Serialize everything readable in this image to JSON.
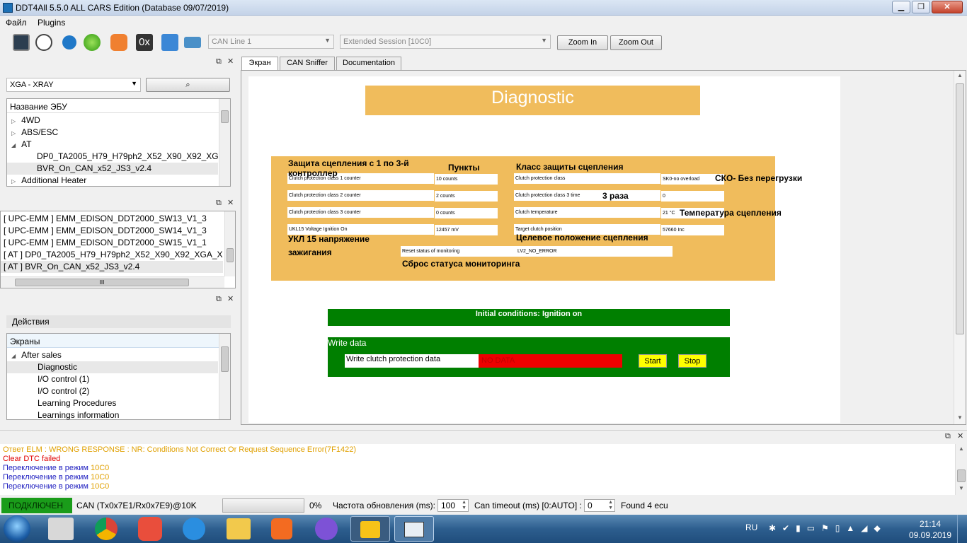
{
  "window": {
    "title": "DDT4All 5.5.0 ALL CARS Edition (Database 09/07/2019)",
    "min": "▁",
    "max": "❐",
    "close": "✕"
  },
  "menu": [
    "Файл",
    "Plugins"
  ],
  "toolbar": {
    "icons": [
      "scan-ecu-icon",
      "bug-icon",
      "refresh-icon",
      "connect-icon",
      "heart-icon",
      "hex-icon",
      "network-icon",
      "settings-icon"
    ],
    "hex_label": "0x",
    "can_line": "CAN Line 1",
    "session": "Extended Session [10C0]",
    "zoom_in": "Zoom In",
    "zoom_out": "Zoom Out"
  },
  "ecu_panel": {
    "selected_vehicle": "XGA - XRAY",
    "header": "Название ЭБУ",
    "items": [
      {
        "label": "4WD",
        "level": 0,
        "expander": "▷"
      },
      {
        "label": "ABS/ESC",
        "level": 0,
        "expander": "▷"
      },
      {
        "label": "AT",
        "level": 0,
        "expander": "◢"
      },
      {
        "label": "DP0_TA2005_H79_H79ph2_X52_X90_X92_XGA_...",
        "level": 1,
        "expander": ""
      },
      {
        "label": "BVR_On_CAN_x52_JS3_v2.4",
        "level": 1,
        "expander": "",
        "selected": true
      },
      {
        "label": "Additional Heater",
        "level": 0,
        "expander": "▷"
      }
    ]
  },
  "found_panel": {
    "items": [
      "[ UPC-EMM ] EMM_EDISON_DDT2000_SW13_V1_3",
      "[ UPC-EMM ] EMM_EDISON_DDT2000_SW14_V1_3",
      "[ UPC-EMM ] EMM_EDISON_DDT2000_SW15_V1_1",
      "[ AT ] DP0_TA2005_H79_H79ph2_X52_X90_X92_XGA_XHA_X...",
      "[ AT ] BVR_On_CAN_x52_JS3_v2.4"
    ],
    "hscroll_grip": "III"
  },
  "actions_panel": {
    "title": "Действия",
    "header": "Экраны",
    "items": [
      {
        "label": "After sales",
        "level": 0,
        "expander": "◢"
      },
      {
        "label": "Diagnostic",
        "level": 1,
        "selected": true
      },
      {
        "label": "I/O control (1)",
        "level": 1
      },
      {
        "label": "I/O control (2)",
        "level": 1
      },
      {
        "label": "Learning Procedures",
        "level": 1
      },
      {
        "label": "Learnings information",
        "level": 1
      }
    ]
  },
  "tabs": [
    "Экран",
    "CAN Sniffer",
    "Documentation"
  ],
  "screen": {
    "title": "Diagnostic",
    "ann_protection_counter": "Защита сцепления с 1 по 3-й контроллер",
    "ann_points": "Пункты",
    "ann_protection_class": "Класс защиты сцепления",
    "ann_sko": "СКО- Без перегрузки",
    "ann_three_times": "3 раза",
    "ann_clutch_temp": "Температура сцепления",
    "ann_ukl": "УКЛ 15 напряжение зажигания",
    "ann_target": "Целевое положение сцепления",
    "ann_reset": "Сброс статуса мониторинга",
    "left_rows": [
      {
        "label": "Clutch protection class 1 counter",
        "value": "10 counts"
      },
      {
        "label": "Clutch protection class 2 counter",
        "value": "2 counts"
      },
      {
        "label": "Clutch protection class 3 counter",
        "value": "0 counts"
      },
      {
        "label": "UKL15 Voltage Ignition On",
        "value": "12457 mV"
      }
    ],
    "right_rows": [
      {
        "label": "Clutch protection class",
        "value": "SK0-no overload"
      },
      {
        "label": "Clutch protection class 3 time",
        "value": "0"
      },
      {
        "label": "Clutch temperature",
        "value": "21 °C"
      },
      {
        "label": "Target clutch position",
        "value": "57660 Inc"
      }
    ],
    "reset_label": "Reset status of monitoring",
    "reset_value": "LV2_NO_ERROR",
    "initial_conditions": "Initial conditions: Ignition on",
    "write_title": "Write data",
    "write_label": "Write clutch protection data",
    "write_value": "NO DATA",
    "start": "Start",
    "stop": "Stop",
    "colors": {
      "orange": "#f0bc5c",
      "green": "#007f00",
      "red": "#ee0000",
      "yellow": "#ffff00"
    }
  },
  "log": [
    {
      "text": "Ответ ELM : WRONG RESPONSE : NR: Conditions Not Correct Or Request Sequence Error(7F1422)",
      "color": "#e0a000"
    },
    {
      "text": "Clear DTC failed",
      "color": "#e00000"
    },
    {
      "prefix": "Переключение в режим ",
      "suffix": "10C0",
      "color": "#2020c0"
    },
    {
      "prefix": "Переключение в режим ",
      "suffix": "10C0",
      "color": "#2020c0"
    },
    {
      "prefix": "Переключение в режим ",
      "suffix": "10C0",
      "color": "#2020c0"
    }
  ],
  "status": {
    "connected": "ПОДКЛЮЧЕН",
    "can_info": "CAN (Tx0x7E1/Rx0x7E9)@10K",
    "progress": "0%",
    "progress_value": 0,
    "refresh_label": "Частота обновления (ms):",
    "refresh_value": "100",
    "timeout_label": "Can timeout (ms) [0:AUTO] :",
    "timeout_value": "0",
    "found": "Found 4 ecu"
  },
  "taskbar": {
    "lang": "RU",
    "time": "21:14",
    "date": "09.09.2019",
    "apps": [
      "start-orb-icon",
      "calculator-icon",
      "chrome-icon",
      "photo-icon",
      "ie-icon",
      "explorer-icon",
      "media-icon",
      "viber-icon",
      "check-engine-icon",
      "ddt4all-icon"
    ]
  }
}
